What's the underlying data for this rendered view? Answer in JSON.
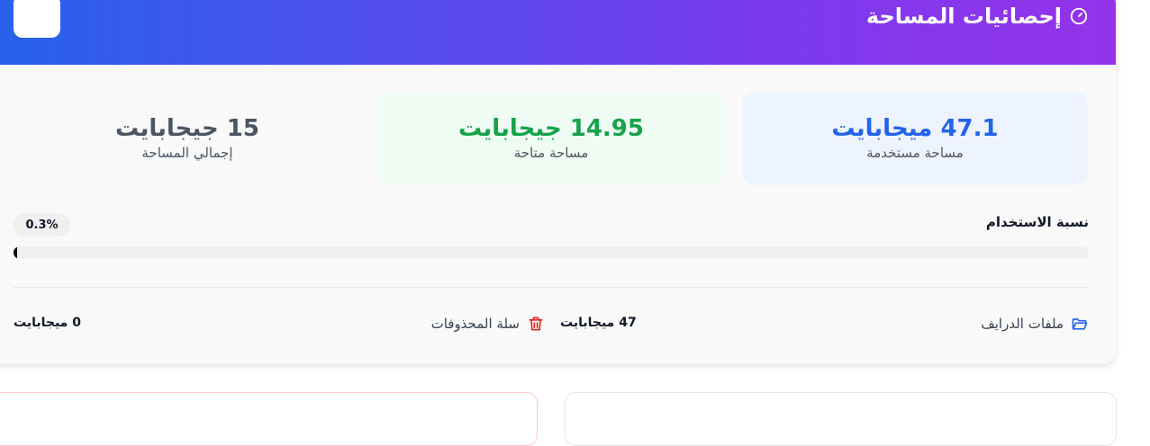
{
  "header": {
    "title": "إحصائيات المساحة",
    "icon": "gauge-icon",
    "gradient_start": "#2563eb",
    "gradient_end": "#9333ea"
  },
  "stats": [
    {
      "value": "47.1 ميجابايت",
      "label": "مساحة مستخدمة",
      "color": "#2563eb"
    },
    {
      "value": "14.95 جيجابايت",
      "label": "مساحة متاحة",
      "color": "#16a34a"
    },
    {
      "value": "15 جيجابايت",
      "label": "إجمالي المساحة",
      "color": "#4b5563"
    }
  ],
  "usage": {
    "label": "نسبة الاستخدام",
    "percent_text": "0.3%",
    "percent": 0.3
  },
  "breakdown": {
    "drive": {
      "label": "ملفات الدرايف",
      "value": "47 ميجابايت",
      "icon": "folder-open-icon",
      "icon_color": "#2563eb"
    },
    "trash": {
      "label": "سلة المحذوفات",
      "value": "0 ميجابايت",
      "icon": "trash-icon",
      "icon_color": "#dc2626"
    }
  }
}
